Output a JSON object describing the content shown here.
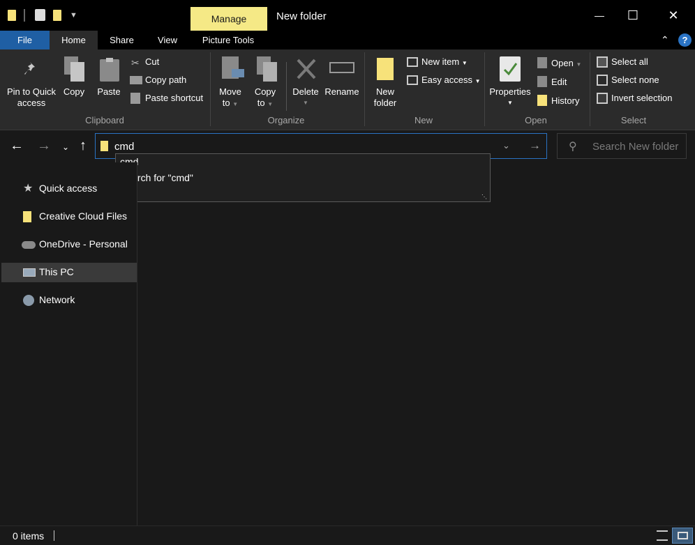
{
  "window": {
    "title": "New folder",
    "context_tab": "Manage",
    "minimize": "—",
    "maximize": "☐",
    "close": "✕"
  },
  "ribbon_tabs": [
    "File",
    "Home",
    "Share",
    "View",
    "Picture Tools"
  ],
  "ribbon": {
    "clipboard": {
      "group": "Clipboard",
      "pin_line1": "Pin to Quick",
      "pin_line2": "access",
      "copy": "Copy",
      "paste": "Paste",
      "cut": "Cut",
      "copy_path": "Copy path",
      "paste_shortcut": "Paste shortcut"
    },
    "organize": {
      "group": "Organize",
      "move_line1": "Move",
      "move_line2": "to",
      "copy_line1": "Copy",
      "copy_line2": "to",
      "delete": "Delete",
      "rename": "Rename"
    },
    "new": {
      "group": "New",
      "new_folder_line1": "New",
      "new_folder_line2": "folder",
      "new_item": "New item",
      "easy_access": "Easy access"
    },
    "open": {
      "group": "Open",
      "properties": "Properties",
      "open": "Open",
      "edit": "Edit",
      "history": "History"
    },
    "select": {
      "group": "Select",
      "select_all": "Select all",
      "select_none": "Select none",
      "invert_selection": "Invert selection"
    }
  },
  "address": {
    "value": "cmd",
    "search_placeholder": "Search New folder"
  },
  "autocomplete": {
    "items": [
      "cmd",
      "Search for \"cmd\""
    ]
  },
  "nav": {
    "items": [
      {
        "label": "Quick access",
        "icon": "star-icon"
      },
      {
        "label": "Creative Cloud Files",
        "icon": "creative-cloud-folder-icon"
      },
      {
        "label": "OneDrive - Personal",
        "icon": "cloud-icon"
      },
      {
        "label": "This PC",
        "icon": "computer-icon",
        "selected": true
      },
      {
        "label": "Network",
        "icon": "network-icon"
      }
    ]
  },
  "status": {
    "items_count": "0 items"
  },
  "colors": {
    "accent": "#2a73c4",
    "file_tab": "#1f5fa4",
    "manage_tab": "#f5e986",
    "folder": "#f7e27a"
  }
}
